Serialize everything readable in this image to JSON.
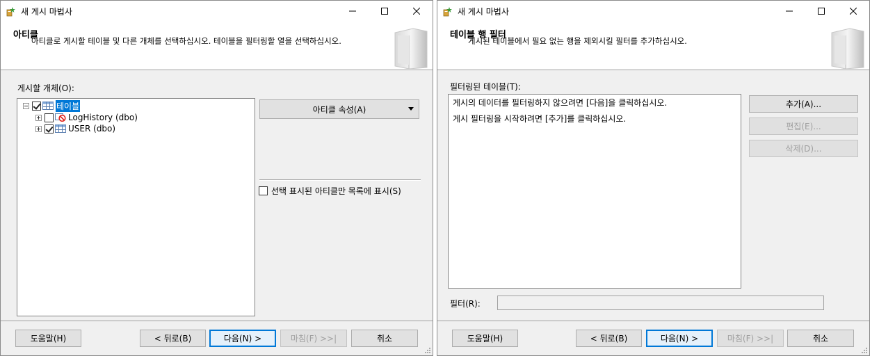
{
  "windows": [
    {
      "title": "새 게시 마법사",
      "header_title": "아티클",
      "header_desc": "아티클로 게시할 테이블 및 다른 개체를 선택하십시오. 테이블을 필터링할 열을 선택하십시오.",
      "objects_label": "게시할 개체(O):",
      "tree": [
        {
          "label": "테이블",
          "checked": true,
          "expanded": true,
          "selected": true
        },
        {
          "label": "LogHistory (dbo)",
          "checked": false
        },
        {
          "label": "USER (dbo)",
          "checked": true
        }
      ],
      "properties_button": "아티클 속성(A)",
      "show_checked_only": "선택 표시된 아티클만 목록에 표시(S)",
      "footer": {
        "help": "도움말(H)",
        "back": "< 뒤로(B)",
        "next": "다음(N) >",
        "finish": "마침(F) >>|",
        "cancel": "취소"
      }
    },
    {
      "title": "새 게시 마법사",
      "header_title": "테이블 행 필터",
      "header_desc": "게시된 테이블에서 필요 없는 행을 제외시킬 필터를 추가하십시오.",
      "filtered_label": "필터링된 테이블(T):",
      "list_lines": [
        "게시의 데이터를 필터링하지 않으려면 [다음]을 클릭하십시오.",
        "게시 필터링을 시작하려면 [추가]를 클릭하십시오."
      ],
      "add": "추가(A)...",
      "edit": "편집(E)...",
      "delete": "삭제(D)...",
      "filter_label": "필터(R):",
      "filter_value": "",
      "footer": {
        "help": "도움말(H)",
        "back": "< 뒤로(B)",
        "next": "다음(N) >",
        "finish": "마침(F) >>|",
        "cancel": "취소"
      }
    }
  ],
  "colors": {
    "selection": "#0078d7",
    "dialog_bg": "#f0f0f0",
    "disabled_text": "#a0a0a0"
  }
}
